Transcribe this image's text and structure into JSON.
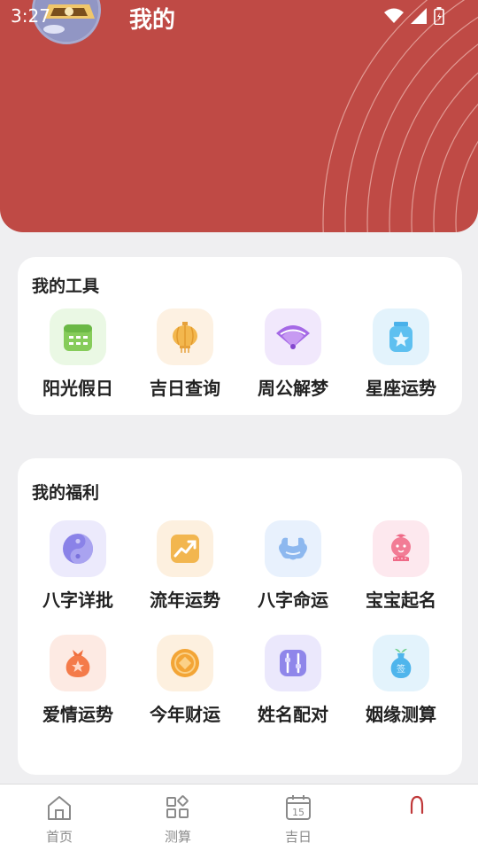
{
  "status": {
    "time": "3:27"
  },
  "header": {
    "title": "我的"
  },
  "tools": {
    "title": "我的工具",
    "items": [
      {
        "label": "阳光假日",
        "icon": "calendar-icon"
      },
      {
        "label": "吉日查询",
        "icon": "lantern-icon"
      },
      {
        "label": "周公解梦",
        "icon": "fan-icon"
      },
      {
        "label": "星座运势",
        "icon": "star-jar-icon"
      }
    ]
  },
  "welfare": {
    "title": "我的福利",
    "items": [
      {
        "label": "八字详批",
        "icon": "yin-yang-icon"
      },
      {
        "label": "流年运势",
        "icon": "trend-chart-icon"
      },
      {
        "label": "八字命运",
        "icon": "cloud-icon"
      },
      {
        "label": "宝宝起名",
        "icon": "baby-icon"
      },
      {
        "label": "爱情运势",
        "icon": "lucky-bag-icon"
      },
      {
        "label": "今年财运",
        "icon": "coin-icon"
      },
      {
        "label": "姓名配对",
        "icon": "sliders-icon"
      },
      {
        "label": "姻缘测算",
        "icon": "vase-icon"
      }
    ]
  },
  "tabbar": {
    "items": [
      {
        "label": "首页",
        "icon": "home-icon"
      },
      {
        "label": "测算",
        "icon": "grid-icon"
      },
      {
        "label": "吉日",
        "icon": "calendar-15-icon",
        "day": "15"
      },
      {
        "label": "",
        "icon": "profile-icon"
      }
    ]
  }
}
